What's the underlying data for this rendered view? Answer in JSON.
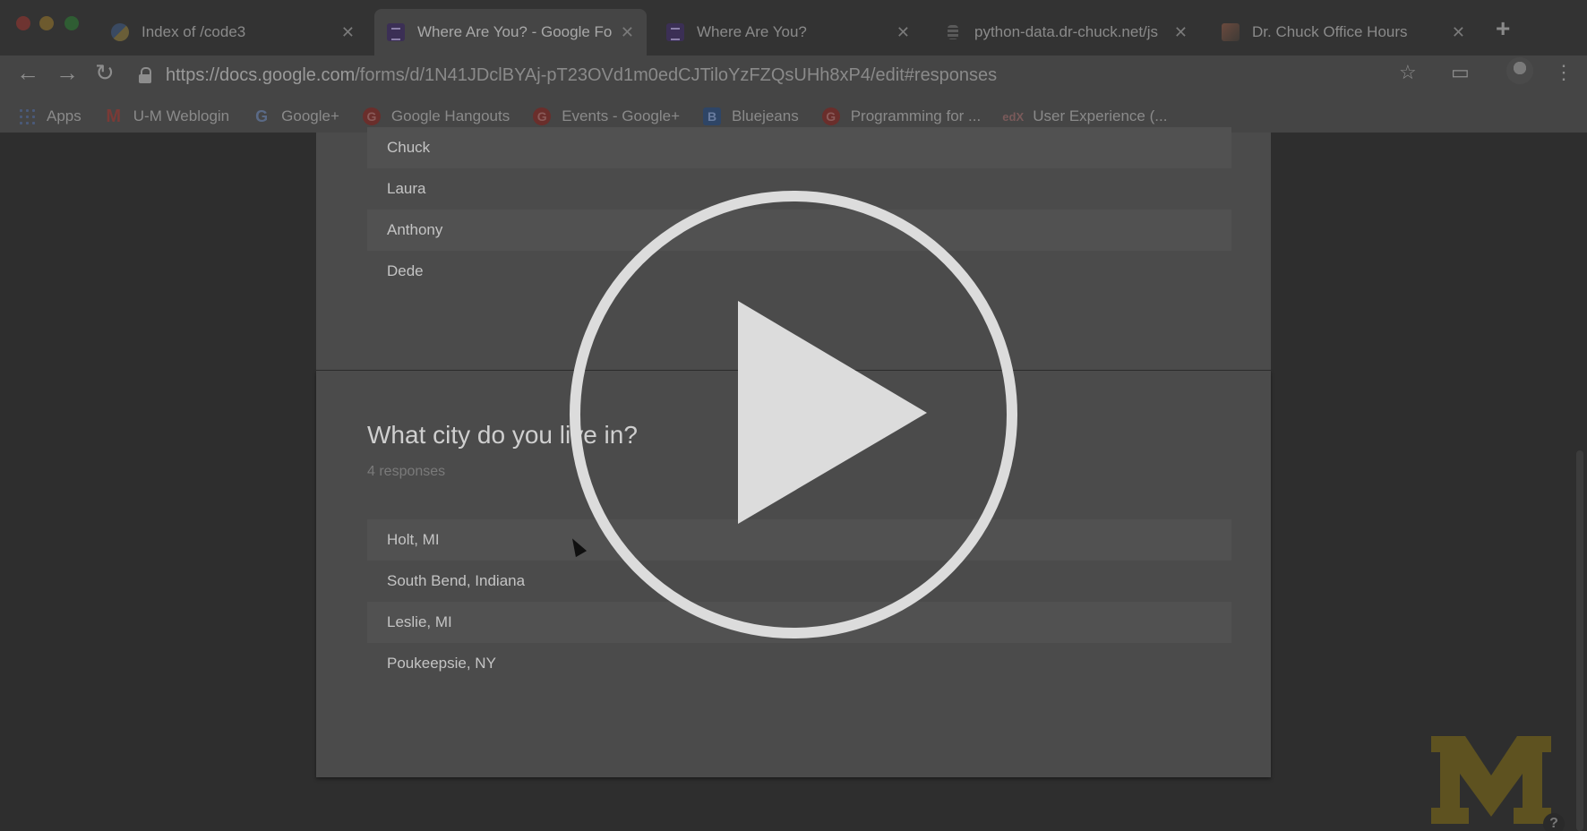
{
  "tabs": [
    {
      "title": "Index of /code3",
      "icon": "python-icon",
      "active": false
    },
    {
      "title": "Where Are You? - Google Fo",
      "icon": "google-forms-icon",
      "active": true
    },
    {
      "title": "Where Are You?",
      "icon": "google-forms-icon",
      "active": false
    },
    {
      "title": "python-data.dr-chuck.net/js",
      "icon": "database-icon",
      "active": false
    },
    {
      "title": "Dr. Chuck Office Hours",
      "icon": "photo-icon",
      "active": false
    }
  ],
  "tab_close_glyph": "✕",
  "new_tab_glyph": "+",
  "address_bar": {
    "host": "https://docs.google.com",
    "path": "/forms/d/1N41JDclBYAj-pT23OVd1m0edCJTiloYzFZQsUHh8xP4/edit#responses"
  },
  "nav": {
    "back": "←",
    "forward": "→",
    "reload": "↻",
    "star": "☆",
    "menu": "⋮",
    "cast": "▭"
  },
  "bookmarks": [
    {
      "label": "Apps",
      "icon": "apps-grid-icon",
      "glyph": ""
    },
    {
      "label": "U-M Weblogin",
      "icon": "gmail-icon",
      "glyph": "M"
    },
    {
      "label": "Google+",
      "icon": "google-icon",
      "glyph": "G"
    },
    {
      "label": "Google Hangouts",
      "icon": "google-plus-icon",
      "glyph": "G"
    },
    {
      "label": "Events - Google+",
      "icon": "google-plus-icon",
      "glyph": "G"
    },
    {
      "label": "Bluejeans",
      "icon": "bluejeans-icon",
      "glyph": "B"
    },
    {
      "label": "Programming for ...",
      "icon": "google-plus-icon",
      "glyph": "G"
    },
    {
      "label": "User Experience (...",
      "icon": "edx-icon",
      "glyph": "edX"
    }
  ],
  "previous_question_responses": [
    "Chuck",
    "Laura",
    "Anthony",
    "Dede"
  ],
  "question": {
    "title": "What city do you live in?",
    "response_count": "4 responses",
    "responses": [
      "Holt, MI",
      "South Bend, Indiana",
      "Leslie, MI",
      "Poukeepsie, NY"
    ]
  },
  "help_glyph": "?",
  "colors": {
    "accent_m_logo": "#5e5220",
    "play_button": "#dcdcdc"
  }
}
